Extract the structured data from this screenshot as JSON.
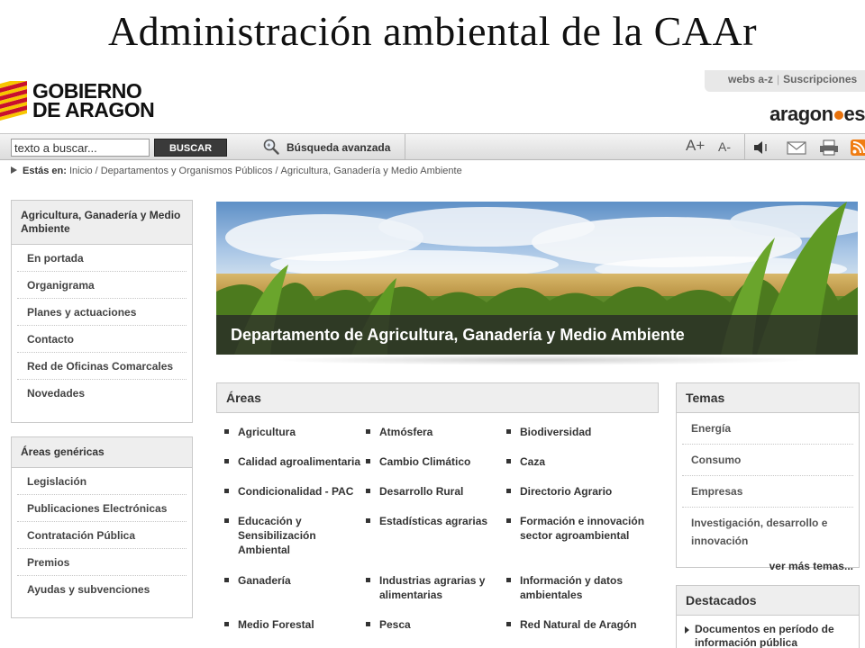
{
  "slide_title": "Administración ambiental de la CAAr",
  "header": {
    "logo_line1": "GOBIERNO",
    "logo_line2": "DE ARAGON",
    "toplinks": [
      "webs a-z",
      "Suscripciones"
    ],
    "portal_logo_a": "aragon",
    "portal_logo_b": "es"
  },
  "toolbar": {
    "search_value": "texto a buscar...",
    "search_button": "BUSCAR",
    "advanced_search": "Búsqueda avanzada",
    "font_increase": "A+",
    "font_decrease": "A-",
    "icons": [
      "speaker-icon",
      "mail-icon",
      "print-icon",
      "rss-icon"
    ]
  },
  "breadcrumb": {
    "label": "Estás en:",
    "items": [
      "Inicio",
      "Departamentos y Organismos Públicos",
      "Agricultura, Ganadería y Medio Ambiente"
    ]
  },
  "sidebar": {
    "department": {
      "title": "Agricultura, Ganadería y Medio Ambiente",
      "items": [
        "En portada",
        "Organigrama",
        "Planes y actuaciones",
        "Contacto",
        "Red de Oficinas Comarcales",
        "Novedades"
      ]
    },
    "generic": {
      "title": "Áreas genéricas",
      "items": [
        "Legislación",
        "Publicaciones Electrónicas",
        "Contratación Pública",
        "Premios",
        "Ayudas y subvenciones"
      ]
    }
  },
  "banner": {
    "caption": "Departamento de Agricultura, Ganadería y Medio Ambiente"
  },
  "areas": {
    "title": "Áreas",
    "items": [
      "Agricultura",
      "Atmósfera",
      "Biodiversidad",
      "Calidad agroalimentaria",
      "Cambio Climático",
      "Caza",
      "Condicionalidad - PAC",
      "Desarrollo Rural",
      "Directorio Agrario",
      "Educación y Sensibilización Ambiental",
      "Estadísticas agrarias",
      "Formación e innovación sector agroambiental",
      "Ganadería",
      "Industrias agrarias y alimentarias",
      "Información y datos ambientales",
      "Medio Forestal",
      "Pesca",
      "Red Natural de Aragón"
    ]
  },
  "temas": {
    "title": "Temas",
    "items": [
      "Energía",
      "Consumo",
      "Empresas",
      "Investigación, desarrollo e innovación"
    ],
    "more": "ver más temas..."
  },
  "destacados": {
    "title": "Destacados",
    "items": [
      "Documentos en período de información pública"
    ]
  }
}
